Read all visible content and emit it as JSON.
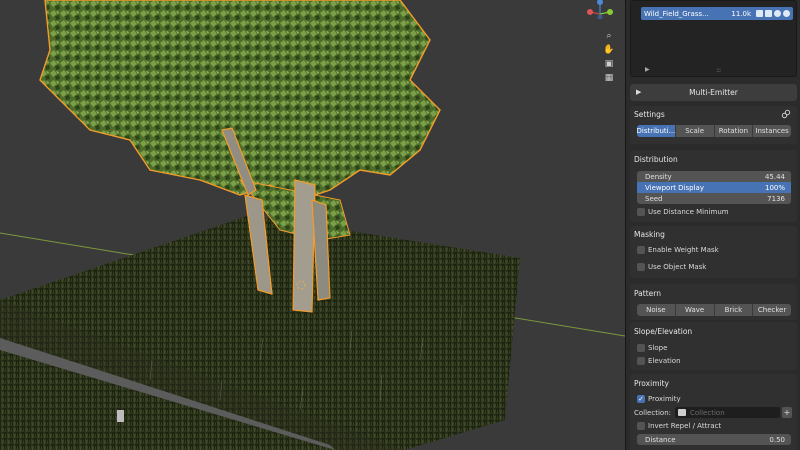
{
  "particle_list": {
    "item_name": "Wild_Field_Grass...",
    "item_count": "11.0k"
  },
  "multi_emitter": {
    "label": "Multi-Emitter"
  },
  "settings": {
    "title": "Settings",
    "tabs": [
      {
        "label": "Distributi...",
        "active": true
      },
      {
        "label": "Scale",
        "active": false
      },
      {
        "label": "Rotation",
        "active": false
      },
      {
        "label": "Instances",
        "active": false
      }
    ]
  },
  "distribution": {
    "title": "Distribution",
    "density_label": "Density",
    "density_value": "45.44",
    "viewport_label": "Viewport Display",
    "viewport_value": "100%",
    "seed_label": "Seed",
    "seed_value": "7136",
    "use_distance_min": "Use Distance Minimum"
  },
  "masking": {
    "title": "Masking",
    "weight_mask": "Enable Weight Mask",
    "object_mask": "Use Object Mask"
  },
  "pattern": {
    "title": "Pattern",
    "tabs": [
      "Noise",
      "Wave",
      "Brick",
      "Checker"
    ]
  },
  "slope": {
    "title": "Slope/Elevation",
    "slope": "Slope",
    "elevation": "Elevation"
  },
  "proximity": {
    "title": "Proximity",
    "proximity_check": "Proximity",
    "collection_label": "Collection:",
    "collection_placeholder": "Collection",
    "invert": "Invert Repel / Attract",
    "distance_label": "Distance",
    "distance_value": "0.50"
  },
  "colors": {
    "accent": "#4772b3",
    "selection_outline": "#f39c2b",
    "panel_bg": "#2b2b2b",
    "viewport_bg": "#3a3a3a"
  }
}
